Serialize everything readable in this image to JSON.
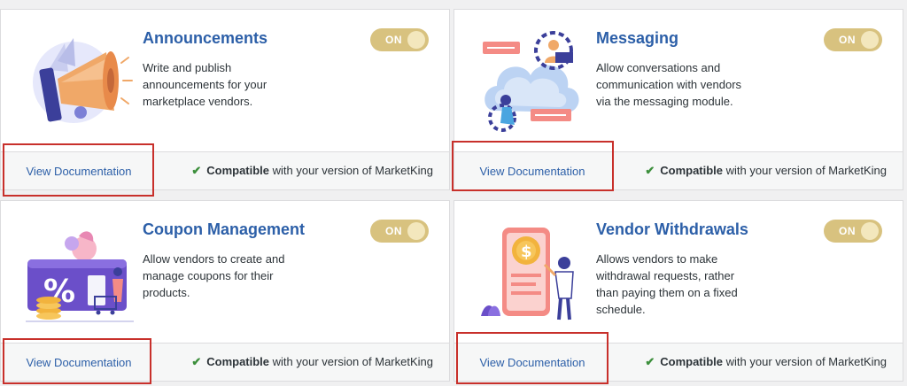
{
  "cards": [
    {
      "title": "Announcements",
      "description": "Write and publish announcements for your marketplace vendors.",
      "toggle": "ON",
      "doc_label": "View Documentation",
      "compat_bold": "Compatible",
      "compat_rest": " with your version of MarketKing",
      "illustration": "megaphone-illustration"
    },
    {
      "title": "Messaging",
      "description": "Allow conversations and communication with vendors via the messaging module.",
      "toggle": "ON",
      "doc_label": "View Documentation",
      "compat_bold": "Compatible",
      "compat_rest": " with your version of MarketKing",
      "illustration": "messaging-cloud-illustration"
    },
    {
      "title": "Coupon Management",
      "description": "Allow vendors to create and manage coupons for their products.",
      "toggle": "ON",
      "doc_label": "View Documentation",
      "compat_bold": "Compatible",
      "compat_rest": " with your version of MarketKing",
      "illustration": "coupon-percent-illustration"
    },
    {
      "title": "Vendor Withdrawals",
      "description": "Allows vendors to make withdrawal requests, rather than paying them on a fixed schedule.",
      "toggle": "ON",
      "doc_label": "View Documentation",
      "compat_bold": "Compatible",
      "compat_rest": " with your version of MarketKing",
      "illustration": "withdrawal-phone-illustration"
    }
  ],
  "colors": {
    "title": "#2c5fa8",
    "toggle_on": "#d8c27f",
    "highlight": "#c8302b",
    "check": "#3c8f3c"
  }
}
